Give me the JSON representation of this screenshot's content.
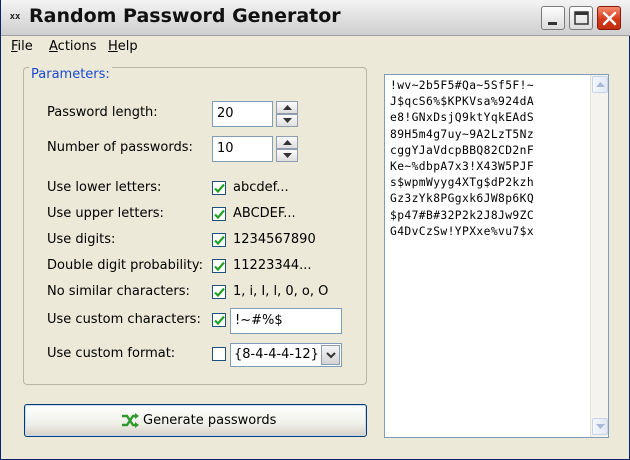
{
  "window": {
    "title": "Random Password Generator",
    "icon_text": "xx"
  },
  "menu": [
    {
      "accel": "F",
      "rest": "ile"
    },
    {
      "accel": "A",
      "rest": "ctions"
    },
    {
      "accel": "H",
      "rest": "elp"
    }
  ],
  "params": {
    "legend": "Parameters:",
    "password_length": {
      "label": "Password length:",
      "value": "20"
    },
    "num_passwords": {
      "label": "Number of passwords:",
      "value": "10"
    },
    "lower": {
      "label": "Use lower letters:",
      "checked": true,
      "sample": "abcdef..."
    },
    "upper": {
      "label": "Use upper letters:",
      "checked": true,
      "sample": "ABCDEF..."
    },
    "digits": {
      "label": "Use digits:",
      "checked": true,
      "sample": "1234567890"
    },
    "double_digit": {
      "label": "Double digit probability:",
      "checked": true,
      "sample": "11223344..."
    },
    "no_similar": {
      "label": "No similar characters:",
      "checked": true,
      "sample": "1, i, I, l, 0, o, O"
    },
    "custom_chars": {
      "label": "Use custom characters:",
      "checked": true,
      "value": "!~#%$"
    },
    "custom_format": {
      "label": "Use custom format:",
      "checked": false,
      "value": "{8-4-4-4-12}"
    }
  },
  "generate_button": {
    "label": "Generate passwords",
    "icon": "shuffle-icon"
  },
  "passwords": [
    "!wv~2b5F5#Qa~5Sf5F!~",
    "J$qcS6%$KPKVsa%924dA",
    "e8!GNxDsjQ9ktYqkEAdS",
    "89H5m4g7uy~9A2LzT5Nz",
    "cggYJaVdcpBBQ82CD2nF",
    "Ke~%dbpA7x3!X43W5PJF",
    "s$wpmWyyg4XTg$dP2kzh",
    "Gz3zYk8PGgxk6JW8p6KQ",
    "$p47#B#32P2k2J8Jw9ZC",
    "G4DvCzSw!YPXxe%vu7$x"
  ]
}
